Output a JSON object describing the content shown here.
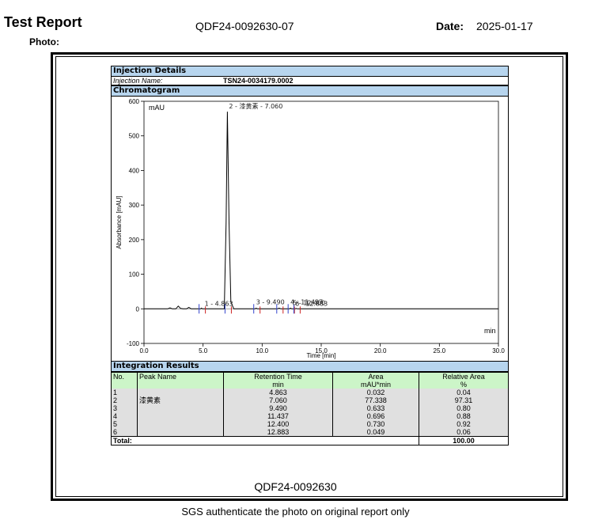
{
  "header": {
    "title": "Test Report",
    "photo_label": "Photo:",
    "report_number": "QDF24-0092630-07",
    "date_label": "Date:",
    "date_value": "2025-01-17"
  },
  "injection": {
    "section_title": "Injection Details",
    "name_label": "Injection Name:",
    "name_value": "TSN24-0034179.0002"
  },
  "chromatogram": {
    "section_title": "Chromatogram",
    "unit_label": "mAU",
    "min_label": "min"
  },
  "chart_data": {
    "type": "line",
    "xlabel": "Time [min]",
    "ylabel": "Absorbance [mAU]",
    "xlim": [
      0,
      30
    ],
    "ylim": [
      -100,
      600
    ],
    "x_ticks": [
      "0.0",
      "5.0",
      "10.0",
      "15.0",
      "20.0",
      "25.0",
      "30.0"
    ],
    "y_ticks": [
      "-100",
      "0",
      "100",
      "200",
      "300",
      "400",
      "500",
      "600"
    ],
    "series": [
      {
        "x": [
          0,
          2.0,
          2.2,
          2.4,
          2.7,
          2.9,
          3.1,
          3.3,
          3.6,
          3.8,
          4.0,
          4.2,
          4.8,
          4.86,
          4.95,
          6.8,
          6.95,
          7.06,
          7.2,
          7.35,
          7.6,
          9.4,
          9.49,
          9.6,
          11.3,
          11.44,
          11.6,
          12.3,
          12.4,
          12.5,
          12.8,
          12.88,
          13.0,
          30
        ],
        "values": [
          0,
          0,
          3,
          0,
          0,
          8,
          1,
          0,
          0,
          4,
          0,
          0,
          0,
          2,
          0,
          0,
          250,
          570,
          250,
          20,
          0,
          0,
          2,
          0,
          0,
          2,
          0,
          0,
          2,
          0,
          0,
          1,
          0,
          0
        ]
      }
    ],
    "peak_labels": [
      {
        "x": 4.863,
        "y": 0,
        "text": "1 - 4.863"
      },
      {
        "x": 7.06,
        "y": 570,
        "text": "2 - 漆黄素 - 7.060"
      },
      {
        "x": 9.49,
        "y": 0,
        "text": "3 - 9.490"
      },
      {
        "x": 12.4,
        "y": 0,
        "text": "4 - 11.437"
      },
      {
        "x": 12.4,
        "y": 0,
        "text": "5 - 12.400"
      },
      {
        "x": 12.4,
        "y": 0,
        "text": "6 - 12.883"
      }
    ]
  },
  "integration": {
    "section_title": "Integration Results",
    "headers": {
      "no": "No.",
      "peak_name": "Peak Name",
      "rt": "Retention Time",
      "rt_unit": "min",
      "area": "Area",
      "area_unit": "mAU*min",
      "rel_area": "Relative Area",
      "rel_unit": "%"
    },
    "rows": [
      {
        "no": "1",
        "name": "",
        "rt": "4.863",
        "area": "0.032",
        "rel": "0.04"
      },
      {
        "no": "2",
        "name": "漆黄素",
        "rt": "7.060",
        "area": "77.338",
        "rel": "97.31"
      },
      {
        "no": "3",
        "name": "",
        "rt": "9.490",
        "area": "0.633",
        "rel": "0.80"
      },
      {
        "no": "4",
        "name": "",
        "rt": "11.437",
        "area": "0.696",
        "rel": "0.88"
      },
      {
        "no": "5",
        "name": "",
        "rt": "12.400",
        "area": "0.730",
        "rel": "0.92"
      },
      {
        "no": "6",
        "name": "",
        "rt": "12.883",
        "area": "0.049",
        "rel": "0.06"
      }
    ],
    "total_label": "Total:",
    "total_value": "100.00"
  },
  "document_code": "QDF24-0092630",
  "footer_note": "SGS authenticate the photo on original report only"
}
